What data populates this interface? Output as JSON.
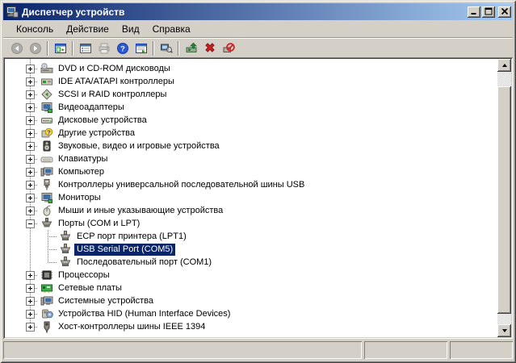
{
  "window": {
    "title": "Диспетчер устройств",
    "icon": "device-manager-icon",
    "controls": [
      {
        "name": "minimize",
        "glyph": "minimize-icon"
      },
      {
        "name": "maximize",
        "glyph": "maximize-icon"
      },
      {
        "name": "close",
        "glyph": "close-icon"
      }
    ]
  },
  "menu_bar": {
    "items": [
      {
        "name": "console",
        "label": "Консоль"
      },
      {
        "name": "action",
        "label": "Действие"
      },
      {
        "name": "view",
        "label": "Вид"
      },
      {
        "name": "help",
        "label": "Справка"
      }
    ]
  },
  "toolbar": {
    "buttons": [
      {
        "name": "back-button",
        "icon": "back-icon",
        "disabled": true
      },
      {
        "name": "forward-button",
        "icon": "forward-icon",
        "disabled": true
      },
      {
        "type": "separator"
      },
      {
        "name": "show-hide-tree-button",
        "icon": "toggle-tree-icon"
      },
      {
        "type": "separator"
      },
      {
        "name": "properties-button",
        "icon": "properties-icon"
      },
      {
        "name": "print-button",
        "icon": "print-icon",
        "disabled": true
      },
      {
        "name": "help-button",
        "icon": "help-icon"
      },
      {
        "name": "export-list-button",
        "icon": "export-list-icon"
      },
      {
        "type": "separator"
      },
      {
        "name": "scan-hardware-button",
        "icon": "scan-icon"
      },
      {
        "type": "separator"
      },
      {
        "name": "update-driver-button",
        "icon": "update-driver-icon"
      },
      {
        "name": "uninstall-button",
        "icon": "uninstall-icon"
      },
      {
        "name": "disable-button",
        "icon": "disable-icon"
      }
    ]
  },
  "device_tree": {
    "items": [
      {
        "label": "DVD и CD-ROM дисководы",
        "icon": "cd-drive-icon",
        "level": 1,
        "expand": "+"
      },
      {
        "label": "IDE ATA/ATAPI контроллеры",
        "icon": "ide-controller-icon",
        "level": 1,
        "expand": "+"
      },
      {
        "label": "SCSI и RAID контроллеры",
        "icon": "scsi-controller-icon",
        "level": 1,
        "expand": "+"
      },
      {
        "label": "Видеоадаптеры",
        "icon": "video-adapter-icon",
        "level": 1,
        "expand": "+"
      },
      {
        "label": "Дисковые устройства",
        "icon": "disk-drive-icon",
        "level": 1,
        "expand": "+"
      },
      {
        "label": "Другие устройства",
        "icon": "unknown-device-icon",
        "level": 1,
        "expand": "+"
      },
      {
        "label": "Звуковые, видео и игровые устройства",
        "icon": "audio-device-icon",
        "level": 1,
        "expand": "+"
      },
      {
        "label": "Клавиатуры",
        "icon": "keyboard-icon",
        "level": 1,
        "expand": "+"
      },
      {
        "label": "Компьютер",
        "icon": "computer-icon",
        "level": 1,
        "expand": "+"
      },
      {
        "label": "Контроллеры универсальной последовательной шины USB",
        "icon": "usb-controller-icon",
        "level": 1,
        "expand": "+"
      },
      {
        "label": "Мониторы",
        "icon": "monitor-icon",
        "level": 1,
        "expand": "+"
      },
      {
        "label": "Мыши и иные указывающие устройства",
        "icon": "mouse-icon",
        "level": 1,
        "expand": "+"
      },
      {
        "label": "Порты (COM и LPT)",
        "icon": "ports-icon",
        "level": 1,
        "expand": "-"
      },
      {
        "label": "ECP порт принтера (LPT1)",
        "icon": "serial-port-icon",
        "level": 2
      },
      {
        "label": "USB Serial Port (COM5)",
        "icon": "serial-port-icon",
        "level": 2,
        "selected": true
      },
      {
        "label": "Последовательный порт (COM1)",
        "icon": "serial-port-icon",
        "level": 2
      },
      {
        "label": "Процессоры",
        "icon": "processor-icon",
        "level": 1,
        "expand": "+"
      },
      {
        "label": "Сетевые платы",
        "icon": "network-card-icon",
        "level": 1,
        "expand": "+"
      },
      {
        "label": "Системные устройства",
        "icon": "system-device-icon",
        "level": 1,
        "expand": "+"
      },
      {
        "label": "Устройства HID (Human Interface Devices)",
        "icon": "hid-device-icon",
        "level": 1,
        "expand": "+"
      },
      {
        "label": "Хост-контроллеры шины IEEE 1394",
        "icon": "ieee1394-icon",
        "level": 1,
        "expand": "+"
      }
    ]
  },
  "status_bar": {
    "panels": [
      "",
      "",
      ""
    ]
  },
  "colors": {
    "titlebar-start": "#0A246A",
    "titlebar-end": "#A6CAF0",
    "selection-bg": "#0A246A",
    "selection-fg": "#FFFFFF",
    "window-face": "#D4D0C8",
    "tree-bg": "#FFFFFF"
  }
}
